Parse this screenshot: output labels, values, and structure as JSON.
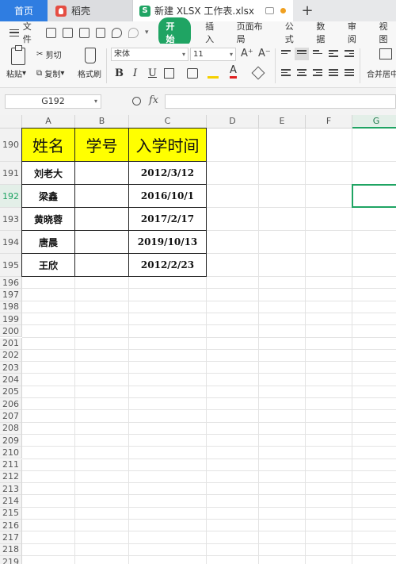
{
  "tabs": {
    "home": "首页",
    "daoke": "稻壳",
    "file_name": "新建 XLSX 工作表.xlsx",
    "add": "+"
  },
  "menu": {
    "file": "文件",
    "items": [
      "开始",
      "插入",
      "页面布局",
      "公式",
      "数据",
      "审阅",
      "视图"
    ]
  },
  "ribbon": {
    "paste": "粘贴",
    "cut": "剪切",
    "copy": "复制",
    "format_painter": "格式刷",
    "font_name": "宋体",
    "font_size": "11",
    "bold": "B",
    "italic": "I",
    "underline": "U",
    "font_color_glyph": "A",
    "grow_font": "A⁺",
    "shrink_font": "A⁻",
    "merge": "合并居中"
  },
  "formula_bar": {
    "cell_ref": "G192",
    "fx": "fx",
    "value": ""
  },
  "sheet": {
    "columns": [
      "A",
      "B",
      "C",
      "D",
      "E",
      "F",
      "G"
    ],
    "selected_column": "G",
    "selected_row": "192",
    "rows": [
      "190",
      "191",
      "192",
      "193",
      "194",
      "195",
      "196",
      "197",
      "198",
      "199",
      "200",
      "201",
      "202",
      "203",
      "204",
      "205",
      "206",
      "207",
      "208",
      "209",
      "210",
      "211",
      "212",
      "213",
      "214",
      "215",
      "216",
      "217",
      "218",
      "219"
    ],
    "table_headers": [
      "姓名",
      "学号",
      "入学时间"
    ],
    "table_rows": [
      {
        "name": "刘老大",
        "id": "",
        "date": "2012/3/12"
      },
      {
        "name": "梁鑫",
        "id": "",
        "date": "2016/10/1"
      },
      {
        "name": "黄晓蓉",
        "id": "",
        "date": "2017/2/17"
      },
      {
        "name": "唐晨",
        "id": "",
        "date": "2019/10/13"
      },
      {
        "name": "王欣",
        "id": "",
        "date": "2012/2/23"
      }
    ]
  },
  "colors": {
    "accent": "#1fa463",
    "header_fill": "#ffff00",
    "home_tab": "#2f7de1"
  }
}
